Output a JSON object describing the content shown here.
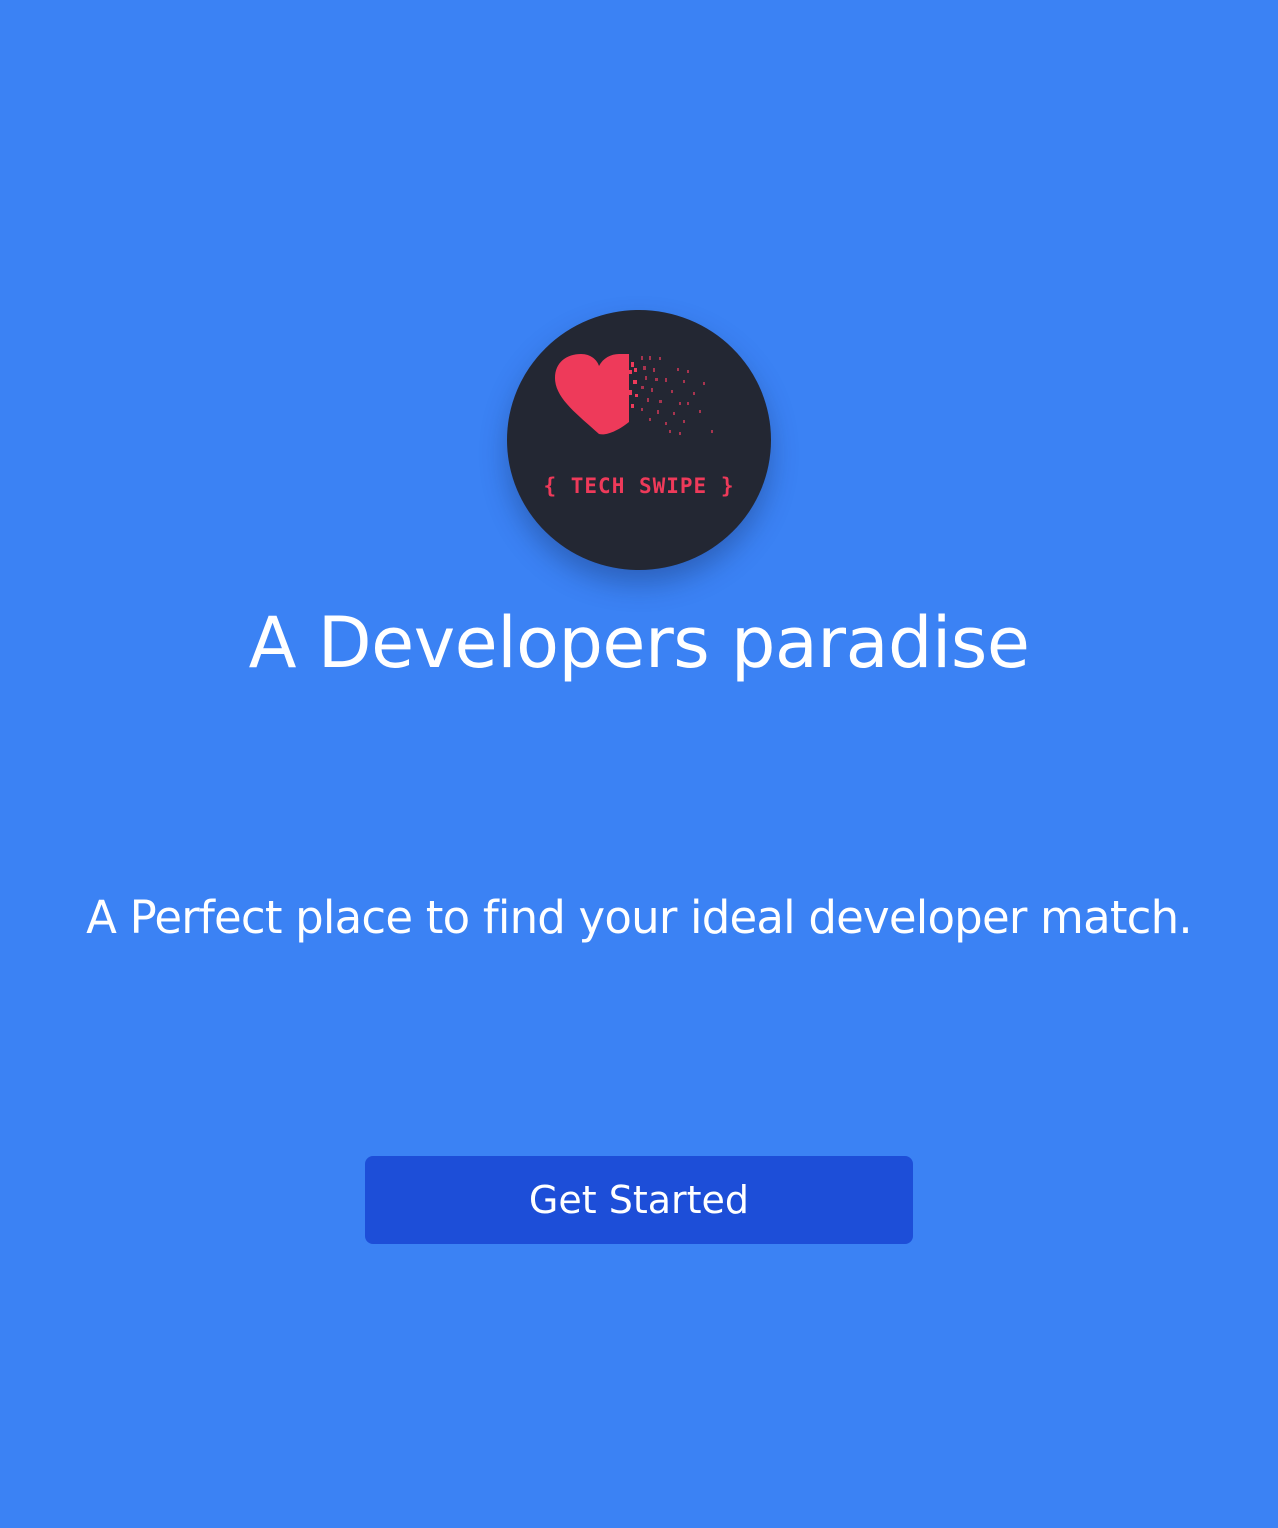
{
  "logo": {
    "wordmark": "{ TECH SWIPE }",
    "heart_color": "#ee3a5a",
    "background_color": "#232733",
    "icon": "heart-pixel-dissolve-icon"
  },
  "hero": {
    "title": "A Developers paradise",
    "subtitle": "A Perfect place to find your ideal developer match."
  },
  "cta": {
    "label": "Get Started"
  },
  "colors": {
    "page_background": "#3b82f4",
    "button_background": "#1d4ed8",
    "text": "#ffffff"
  }
}
